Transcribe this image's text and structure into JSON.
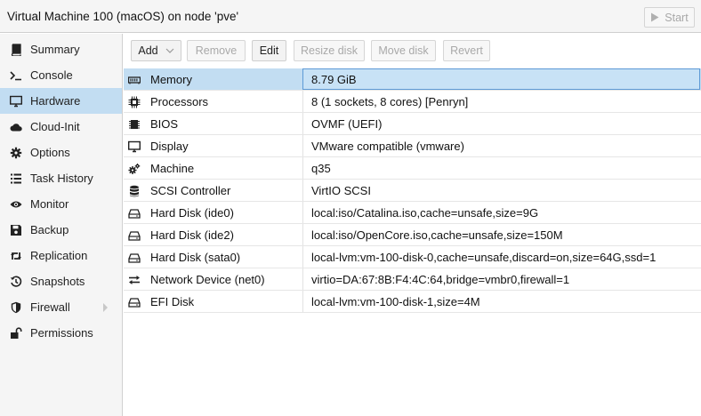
{
  "window": {
    "title": "Virtual Machine 100 (macOS) on node 'pve'",
    "start_label": "Start"
  },
  "sidebar": {
    "items": [
      {
        "label": "Summary",
        "icon": "book-icon"
      },
      {
        "label": "Console",
        "icon": "terminal-icon"
      },
      {
        "label": "Hardware",
        "icon": "monitor-icon",
        "active": true
      },
      {
        "label": "Cloud-Init",
        "icon": "cloud-icon"
      },
      {
        "label": "Options",
        "icon": "gear-icon"
      },
      {
        "label": "Task History",
        "icon": "list-icon"
      },
      {
        "label": "Monitor",
        "icon": "eye-icon"
      },
      {
        "label": "Backup",
        "icon": "floppy-icon"
      },
      {
        "label": "Replication",
        "icon": "retweet-icon"
      },
      {
        "label": "Snapshots",
        "icon": "history-icon"
      },
      {
        "label": "Firewall",
        "icon": "shield-icon"
      },
      {
        "label": "Permissions",
        "icon": "unlock-icon"
      }
    ]
  },
  "toolbar": {
    "add": "Add",
    "remove": "Remove",
    "edit": "Edit",
    "resize": "Resize disk",
    "move": "Move disk",
    "revert": "Revert"
  },
  "hardware": {
    "rows": [
      {
        "key": "Memory",
        "value": "8.79 GiB",
        "icon": "memory-icon"
      },
      {
        "key": "Processors",
        "value": "8 (1 sockets, 8 cores) [Penryn]",
        "icon": "cpu-icon"
      },
      {
        "key": "BIOS",
        "value": "OVMF (UEFI)",
        "icon": "chip-icon"
      },
      {
        "key": "Display",
        "value": "VMware compatible (vmware)",
        "icon": "desktop-icon"
      },
      {
        "key": "Machine",
        "value": "q35",
        "icon": "cogs-icon"
      },
      {
        "key": "SCSI Controller",
        "value": "VirtIO SCSI",
        "icon": "database-icon"
      },
      {
        "key": "Hard Disk (ide0)",
        "value": "local:iso/Catalina.iso,cache=unsafe,size=9G",
        "icon": "hdd-icon"
      },
      {
        "key": "Hard Disk (ide2)",
        "value": "local:iso/OpenCore.iso,cache=unsafe,size=150M",
        "icon": "hdd-icon"
      },
      {
        "key": "Hard Disk (sata0)",
        "value": "local-lvm:vm-100-disk-0,cache=unsafe,discard=on,size=64G,ssd=1",
        "icon": "hdd-icon"
      },
      {
        "key": "Network Device (net0)",
        "value": "virtio=DA:67:8B:F4:4C:64,bridge=vmbr0,firewall=1",
        "icon": "exchange-icon"
      },
      {
        "key": "EFI Disk",
        "value": "local-lvm:vm-100-disk-1,size=4M",
        "icon": "hdd-icon"
      }
    ]
  }
}
